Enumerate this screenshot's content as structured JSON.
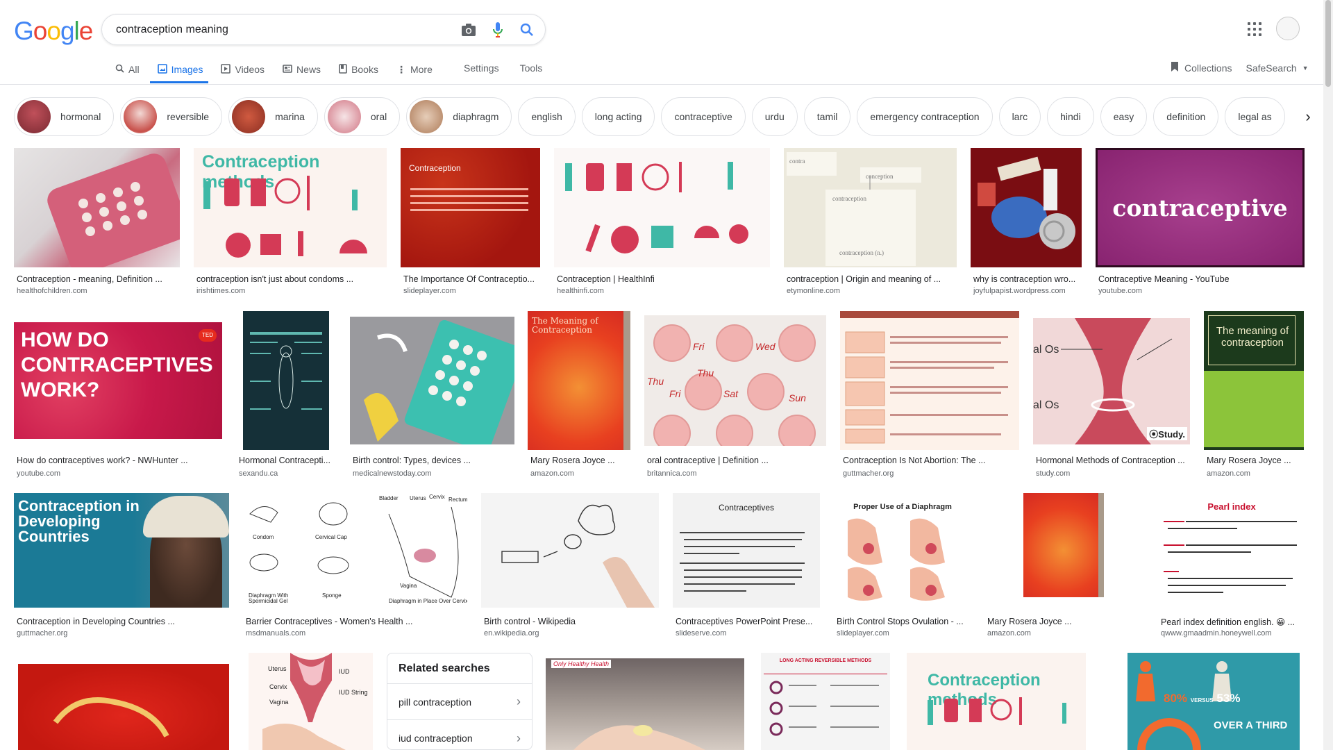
{
  "logo": "Google",
  "search": {
    "query": "contraception meaning"
  },
  "tabs": [
    {
      "label": "All",
      "icon": "search-icon"
    },
    {
      "label": "Images",
      "icon": "image-icon"
    },
    {
      "label": "Videos",
      "icon": "video-icon"
    },
    {
      "label": "News",
      "icon": "news-icon"
    },
    {
      "label": "Books",
      "icon": "book-icon"
    },
    {
      "label": "More",
      "icon": "more-icon"
    }
  ],
  "settings": "Settings",
  "tools": "Tools",
  "collections": "Collections",
  "safesearch": "SafeSearch",
  "chips": [
    {
      "label": "hormonal",
      "thumb": "#b03a48"
    },
    {
      "label": "reversible",
      "thumb": "#e8c4c0"
    },
    {
      "label": "marina",
      "thumb": "#c0503a"
    },
    {
      "label": "oral",
      "thumb": "#f0d5d8"
    },
    {
      "label": "diaphragm",
      "thumb": "#d9b8a0"
    },
    {
      "label": "english"
    },
    {
      "label": "long acting"
    },
    {
      "label": "contraceptive"
    },
    {
      "label": "urdu"
    },
    {
      "label": "tamil"
    },
    {
      "label": "emergency contraception"
    },
    {
      "label": "larc"
    },
    {
      "label": "hindi"
    },
    {
      "label": "easy"
    },
    {
      "label": "definition"
    },
    {
      "label": "legal as"
    }
  ],
  "results_row1": [
    {
      "title": "Contraception - meaning, Definition ...",
      "source": "healthofchildren.com"
    },
    {
      "title": "contraception isn't just about condoms ...",
      "source": "irishtimes.com",
      "thumb_text": "Contraception methods"
    },
    {
      "title": "The Importance Of Contraceptio...",
      "source": "slideplayer.com",
      "thumb_text": "Contraception"
    },
    {
      "title": "Contraception | HealthInfi",
      "source": "healthinfi.com"
    },
    {
      "title": "contraception | Origin and meaning of ...",
      "source": "etymonline.com"
    },
    {
      "title": "why is contraception wro...",
      "source": "joyfulpapist.wordpress.com"
    },
    {
      "title": "Contraceptive Meaning - YouTube",
      "source": "youtube.com",
      "thumb_text": "contraceptive"
    }
  ],
  "results_row2": [
    {
      "title": "How do contraceptives work? - NWHunter ...",
      "source": "youtube.com",
      "thumb_text": "HOW DO CONTRACEPTIVES WORK?"
    },
    {
      "title": "Hormonal Contracepti...",
      "source": "sexandu.ca"
    },
    {
      "title": "Birth control: Types, devices ...",
      "source": "medicalnewstoday.com"
    },
    {
      "title": "Mary Rosera Joyce ...",
      "source": "amazon.com",
      "thumb_text": "The Meaning of Contraception"
    },
    {
      "title": "oral contraceptive | Definition ...",
      "source": "britannica.com"
    },
    {
      "title": "Contraception Is Not Abortion: The ...",
      "source": "guttmacher.org"
    },
    {
      "title": "Hormonal Methods of Contraception ...",
      "source": "study.com"
    },
    {
      "title": "Mary Rosera Joyce ...",
      "source": "amazon.com",
      "thumb_text": "The meaning of contraception"
    }
  ],
  "results_row3": [
    {
      "title": "Contraception in Developing Countries ...",
      "source": "guttmacher.org",
      "thumb_text": "Contraception in Developing Countries"
    },
    {
      "title": "Barrier Contraceptives - Women's Health ...",
      "source": "msdmanuals.com"
    },
    {
      "title": "Birth control - Wikipedia",
      "source": "en.wikipedia.org"
    },
    {
      "title": "Contraceptives PowerPoint Prese...",
      "source": "slideserve.com",
      "thumb_text": "Contraceptives"
    },
    {
      "title": "Birth Control Stops Ovulation - ...",
      "source": "slideplayer.com",
      "thumb_text": "Proper Use of a Diaphragm"
    },
    {
      "title": "Mary Rosera Joyce ...",
      "source": "amazon.com"
    },
    {
      "title": "Pearl index definition english. 😀 ...",
      "source": "qwww.gmaadmin.honeywell.com",
      "thumb_text": "Pearl index"
    }
  ],
  "related": {
    "heading": "Related searches",
    "items": [
      "pill contraception",
      "iud contraception"
    ]
  },
  "row4_texts": {
    "methods": "Contraception methods",
    "percent_a": "80%",
    "versus": "VERSUS",
    "percent_b": "53%",
    "over_third": "OVER A THIRD",
    "larc": "LONG ACTING REVERSIBLE METHODS"
  }
}
